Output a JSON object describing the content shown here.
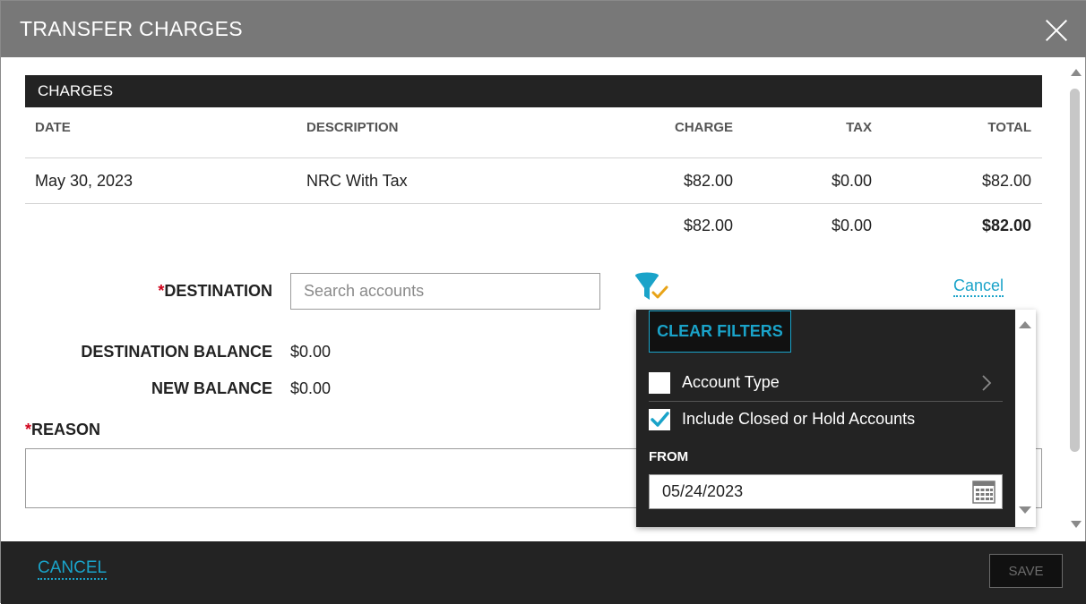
{
  "dialog": {
    "title": "TRANSFER CHARGES"
  },
  "charges": {
    "section_title": "CHARGES",
    "columns": [
      "DATE",
      "DESCRIPTION",
      "CHARGE",
      "TAX",
      "TOTAL"
    ],
    "rows": [
      {
        "date": "May 30, 2023",
        "description": "NRC With Tax",
        "charge": "$82.00",
        "tax": "$0.00",
        "total": "$82.00"
      }
    ],
    "totals": {
      "charge": "$82.00",
      "tax": "$0.00",
      "total": "$82.00"
    }
  },
  "form": {
    "required_mark": "*",
    "destination_label": "DESTINATION",
    "search_placeholder": "Search accounts",
    "search_value": "",
    "cancel_link": "Cancel",
    "destination_balance_label": "DESTINATION BALANCE",
    "destination_balance_value": "$0.00",
    "new_balance_label": "NEW BALANCE",
    "new_balance_value": "$0.00",
    "reason_label": "REASON",
    "reason_value": ""
  },
  "filter_popup": {
    "clear_filters_label": "CLEAR FILTERS",
    "options": [
      {
        "label": "Account Type",
        "checked": false,
        "has_submenu": true
      },
      {
        "label": "Include Closed or Hold Accounts",
        "checked": true,
        "has_submenu": false
      }
    ],
    "from_label": "FROM",
    "from_value": "05/24/2023"
  },
  "footer": {
    "cancel_label": "CANCEL",
    "save_label": "SAVE"
  },
  "colors": {
    "titlebar": "#787878",
    "dark_panel": "#232323",
    "link_accent": "#1aa3c9",
    "required": "#d0021b",
    "filter_icon": "#1aa3c9",
    "filter_check": "#e8a317"
  },
  "icons": [
    "close-icon",
    "filter-icon",
    "chevron-right-icon",
    "calendar-icon",
    "checkmark-icon"
  ]
}
